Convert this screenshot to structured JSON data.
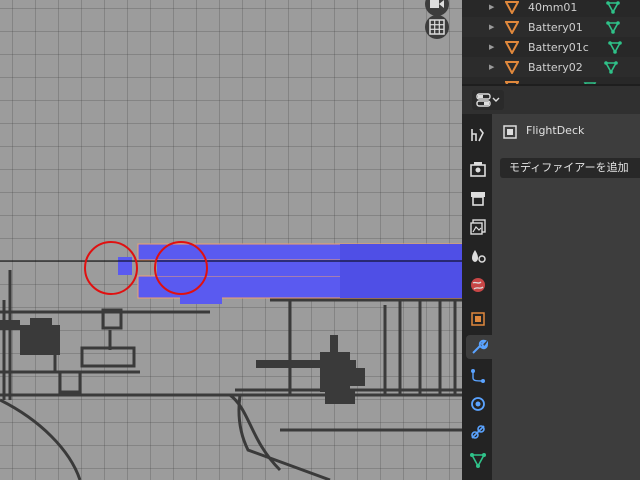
{
  "outliner": {
    "items": [
      {
        "label": "40mm01"
      },
      {
        "label": "Battery01"
      },
      {
        "label": "Battery01c"
      },
      {
        "label": "Battery02"
      }
    ]
  },
  "properties": {
    "object_name": "FlightDeck",
    "add_modifier_label": "モディファイアーを追加",
    "tabs": [
      {
        "icon": "tool-icon"
      },
      {
        "icon": "render-icon"
      },
      {
        "icon": "output-icon"
      },
      {
        "icon": "view-layer-icon"
      },
      {
        "icon": "scene-icon"
      },
      {
        "icon": "world-icon"
      },
      {
        "icon": "object-icon"
      },
      {
        "icon": "modifier-wrench-icon",
        "active": true
      },
      {
        "icon": "particles-icon"
      },
      {
        "icon": "physics-icon"
      },
      {
        "icon": "constraints-icon"
      },
      {
        "icon": "object-data-icon"
      }
    ]
  },
  "colors": {
    "selection_blue": "#5a5af0",
    "highlight_red": "#e01010",
    "accent_orange": "#e0883c",
    "data_green": "#2fc289"
  }
}
